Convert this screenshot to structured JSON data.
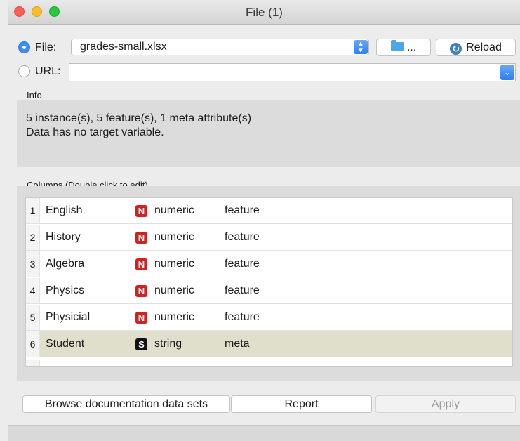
{
  "window": {
    "title": "File (1)"
  },
  "source": {
    "file_label": "File:",
    "file_value": "grades-small.xlsx",
    "browse_label": "...",
    "reload_label": "Reload",
    "url_label": "URL:",
    "url_value": ""
  },
  "info": {
    "label": "Info",
    "line1": "5 instance(s), 5 feature(s), 1 meta attribute(s)",
    "line2": "Data has no target variable."
  },
  "columns": {
    "label": "Columns (Double click to edit)",
    "rows": [
      {
        "num": "1",
        "name": "English",
        "type_icon": "N",
        "type": "numeric",
        "role": "feature"
      },
      {
        "num": "2",
        "name": "History",
        "type_icon": "N",
        "type": "numeric",
        "role": "feature"
      },
      {
        "num": "3",
        "name": "Algebra",
        "type_icon": "N",
        "type": "numeric",
        "role": "feature"
      },
      {
        "num": "4",
        "name": "Physics",
        "type_icon": "N",
        "type": "numeric",
        "role": "feature"
      },
      {
        "num": "5",
        "name": "Physicial",
        "type_icon": "N",
        "type": "numeric",
        "role": "feature"
      },
      {
        "num": "6",
        "name": "Student",
        "type_icon": "S",
        "type": "string",
        "role": "meta"
      }
    ]
  },
  "buttons": {
    "docs": "Browse documentation data sets",
    "report": "Report",
    "apply": "Apply"
  },
  "colors": {
    "numeric_icon": "#d02222",
    "string_icon": "#111111",
    "selected_row": "#dfdfcb",
    "accent": "#3d8ef8"
  }
}
